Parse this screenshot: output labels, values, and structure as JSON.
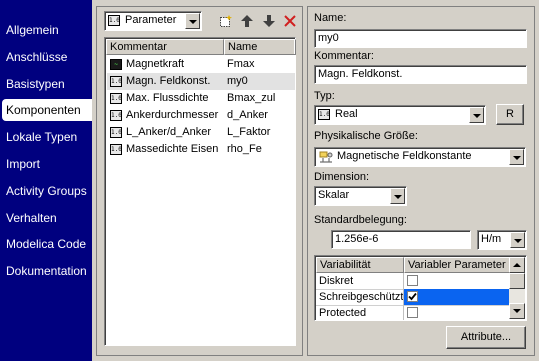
{
  "nav": {
    "items": [
      {
        "label": "Allgemein"
      },
      {
        "label": "Anschlüsse"
      },
      {
        "label": "Basistypen"
      },
      {
        "label": "Komponenten"
      },
      {
        "label": "Lokale Typen"
      },
      {
        "label": "Import"
      },
      {
        "label": "Activity Groups"
      },
      {
        "label": "Verhalten"
      },
      {
        "label": "Modelica Code"
      },
      {
        "label": "Dokumentation"
      }
    ],
    "active": "Komponenten"
  },
  "components": {
    "type_filter": {
      "value": "Parameter",
      "icon_text": "1.0"
    },
    "toolbar": {
      "new": "new-item-icon",
      "up": "arrow-up-icon",
      "down": "arrow-down-icon",
      "delete": "delete-x-icon"
    },
    "columns": {
      "comment": "Kommentar",
      "name": "Name"
    },
    "rows": [
      {
        "comment": "Magnetkraft",
        "name": "Fmax",
        "icon": "plot-icon"
      },
      {
        "comment": "Magn. Feldkonst.",
        "name": "my0",
        "icon": "parameter-icon"
      },
      {
        "comment": "Max. Flussdichte",
        "name": "Bmax_zul",
        "icon": "parameter-icon"
      },
      {
        "comment": "Ankerdurchmesser",
        "name": "d_Anker",
        "icon": "parameter-icon"
      },
      {
        "comment": "L_Anker/d_Anker",
        "name": "L_Faktor",
        "icon": "parameter-icon"
      },
      {
        "comment": "Massedichte Eisen",
        "name": "rho_Fe",
        "icon": "parameter-icon"
      }
    ],
    "selected_index": 1
  },
  "details": {
    "name_label": "Name:",
    "name_value": "my0",
    "comment_label": "Kommentar:",
    "comment_value": "Magn. Feldkonst.",
    "type_label": "Typ:",
    "type_value": "Real",
    "type_button": "R",
    "quantity_label": "Physikalische Größe:",
    "quantity_value": "Magnetische Feldkonstante",
    "dimension_label": "Dimension:",
    "dimension_value": "Skalar",
    "default_label": "Standardbelegung:",
    "default_value": "1.256e-6",
    "unit_value": "H/m",
    "attributes_button": "Attribute..."
  },
  "variability": {
    "columns": {
      "name": "Variabilität",
      "value": "Variabler Parameter"
    },
    "rows": [
      {
        "name": "Diskret",
        "checked": false
      },
      {
        "name": "Schreibgeschützt",
        "checked": true
      },
      {
        "name": "Protected",
        "checked": false
      }
    ],
    "selected_index": 1,
    "selection_color": "#0a64f0"
  },
  "colors": {
    "nav_bg": "#00007f",
    "window_bg": "#d4d0c8"
  }
}
